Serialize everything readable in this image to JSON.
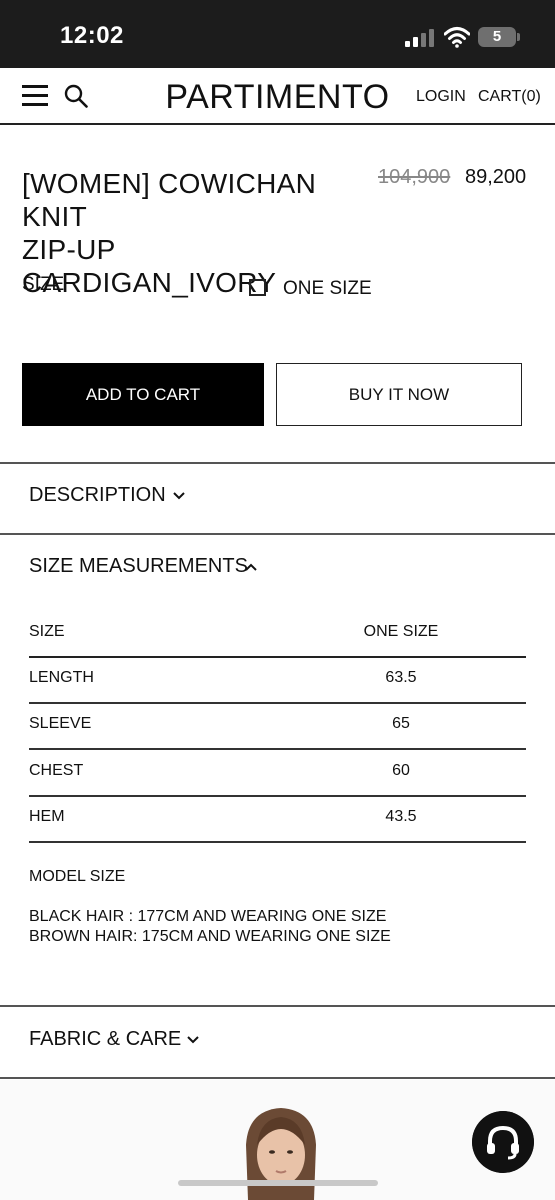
{
  "status_bar": {
    "time": "12:02",
    "battery": "5"
  },
  "header": {
    "brand": "PARTIMENTO",
    "login": "LOGIN",
    "cart": "CART(0)",
    "icons": [
      "menu-icon",
      "search-icon"
    ]
  },
  "product": {
    "title_line1": "[WOMEN] COWICHAN KNIT",
    "title_line2": "ZIP-UP CARDIGAN_IVORY",
    "original_price": "104,900",
    "sale_price": "89,200",
    "size_label": "SIZE",
    "size_option": "ONE SIZE"
  },
  "buttons": {
    "add_to_cart": "ADD TO CART",
    "buy_now": "BUY IT NOW"
  },
  "accordions": {
    "description": "DESCRIPTION",
    "size_measurements": "SIZE MEASUREMENTS",
    "fabric_care": "FABRIC & CARE"
  },
  "size_table": {
    "header": [
      "SIZE",
      "ONE SIZE"
    ],
    "rows": [
      [
        "LENGTH",
        "63.5"
      ],
      [
        "SLEEVE",
        "65"
      ],
      [
        "CHEST",
        "60"
      ],
      [
        "HEM",
        "43.5"
      ]
    ]
  },
  "model_size": {
    "title": "MODEL SIZE",
    "line1": "BLACK HAIR : 177CM AND WEARING ONE SIZE",
    "line2": "BROWN HAIR: 175CM AND WEARING ONE SIZE"
  },
  "colors": {
    "status_bar": "#1c1c1c",
    "primary_button": "#000000",
    "strike_price": "#888888"
  }
}
